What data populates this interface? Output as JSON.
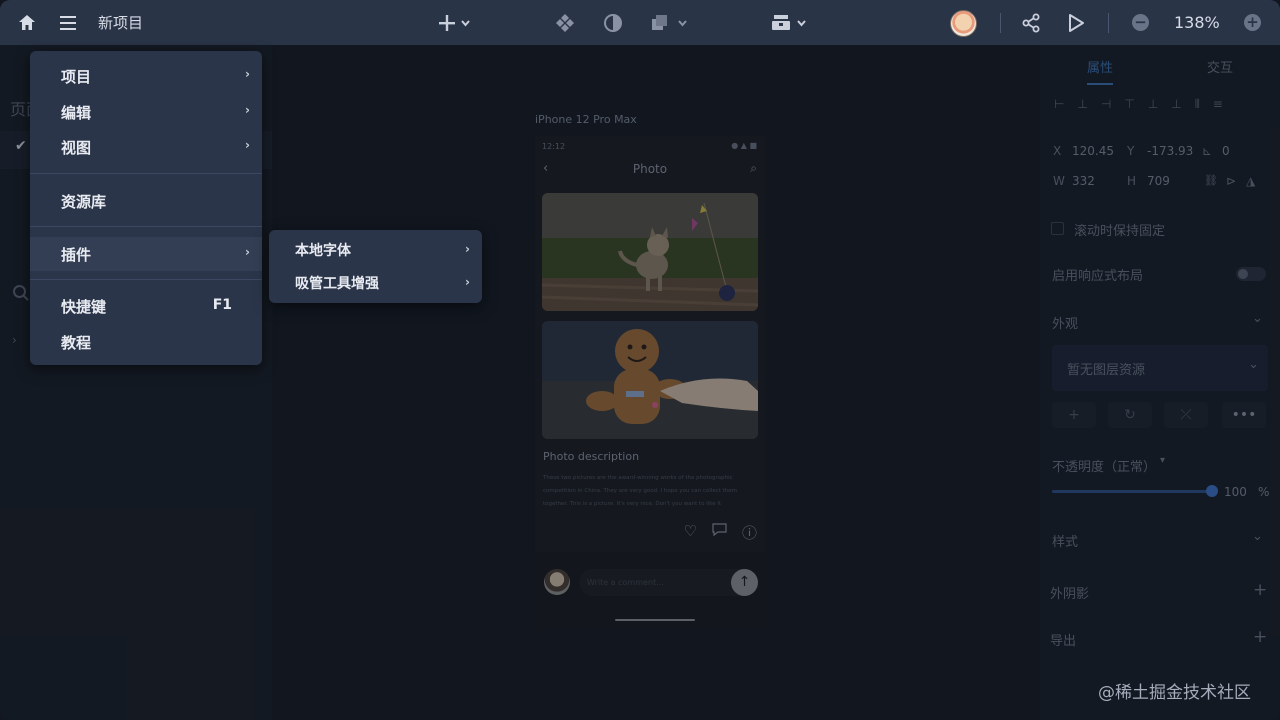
{
  "app": {
    "title": "新项目",
    "zoom": "138%",
    "zoom_minus": "−",
    "zoom_plus": "+"
  },
  "left_panel": {
    "pages_label": "页面",
    "check": "✔",
    "search_icon": "⌕",
    "chevron": "›"
  },
  "canvas": {
    "device_label": "iPhone 12 Pro Max",
    "phone": {
      "time": "12:12",
      "status_icons": "● ▲ ■",
      "title": "Photo",
      "back": "‹",
      "search": "⌕",
      "desc_title": "Photo description",
      "desc_text": "These two pictures are the award-winning works of the photographic competition in China. They are very good. I hope you can collect them together. This is a picture. It's very nice. Don't you want to like it",
      "comment_placeholder": "Write a comment...",
      "send": "↑",
      "action_like": "♡",
      "action_comment": "💬",
      "action_info": "ⓘ"
    }
  },
  "right_panel": {
    "tabs": [
      "属性",
      "交互"
    ],
    "active_tab": 0,
    "align_icons": [
      "⊢",
      "⊥",
      "⊣",
      "⊤",
      "⊥",
      "⊥",
      "⫴",
      "≡"
    ],
    "x_label": "X",
    "x_value": "120.45",
    "y_label": "Y",
    "y_value": "-173.93",
    "angle_value": "0",
    "w_label": "W",
    "w_value": "332",
    "h_label": "H",
    "h_value": "709",
    "fixed_on_scroll": "滚动时保持固定",
    "responsive_layout": "启用响应式布局",
    "appearance": "外观",
    "no_layer_resources": "暂无图层资源",
    "opacity_label": "不透明度（正常）",
    "opacity_value": "100",
    "opacity_unit": "%",
    "opacity_level": 1.0,
    "style": "样式",
    "shadow": "外阴影",
    "export": "导出",
    "btn_add": "+",
    "btn_more": "•••",
    "plus": "+"
  },
  "menu": {
    "items": [
      {
        "label": "项目",
        "arrow": "›"
      },
      {
        "label": "编辑",
        "arrow": "›"
      },
      {
        "label": "视图",
        "arrow": "›"
      },
      {
        "label": "资源库"
      },
      {
        "label": "插件",
        "arrow": "›"
      },
      {
        "label": "快捷键",
        "shortcut": "F1"
      },
      {
        "label": "教程"
      }
    ]
  },
  "submenu": {
    "items": [
      {
        "label": "本地字体",
        "arrow": "›"
      },
      {
        "label": "吸管工具增强",
        "arrow": "›"
      }
    ]
  },
  "watermark": "@稀土掘金技术社区",
  "colors": {
    "topbar": "#2a3447",
    "menu": "#2b3549",
    "accent": "#3d6fae"
  }
}
